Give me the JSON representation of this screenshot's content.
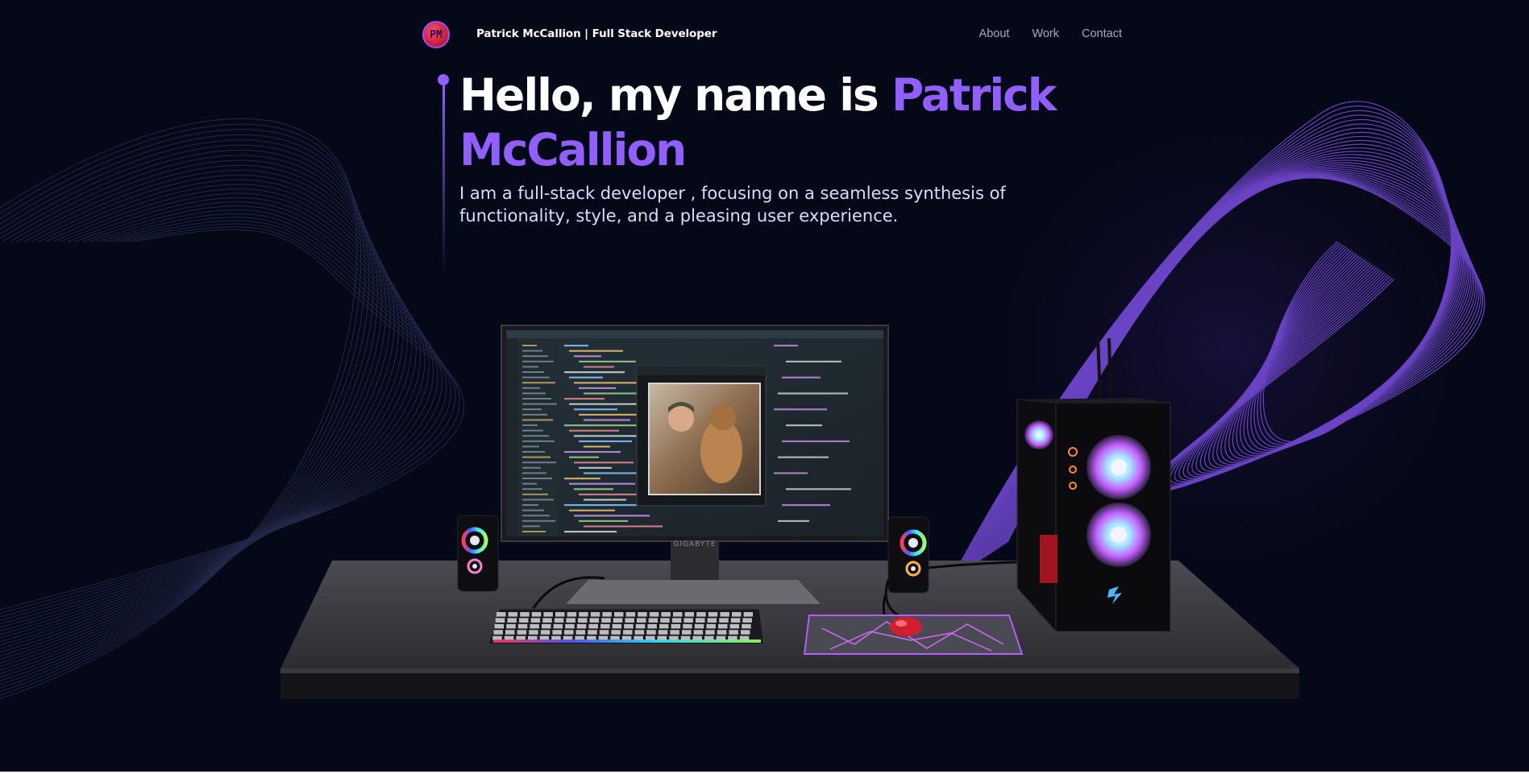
{
  "nav": {
    "logo_text": "PM",
    "brand": "Patrick McCallion | Full Stack Developer",
    "links": [
      "About",
      "Work",
      "Contact"
    ]
  },
  "hero": {
    "title_intro": "Hello, my name is ",
    "title_name_1": "Patrick",
    "title_name_2": "McCallion",
    "subtitle": "I am a full-stack developer , focusing on a seamless synthesis of functionality, style, and a pleasing user experience."
  },
  "scene": {
    "monitor_brand": "GIGABYTE"
  },
  "colors": {
    "background": "#050816",
    "accent": "#915eff",
    "subtitle": "#dfd9ff",
    "nav_link": "#aaa6c3"
  }
}
